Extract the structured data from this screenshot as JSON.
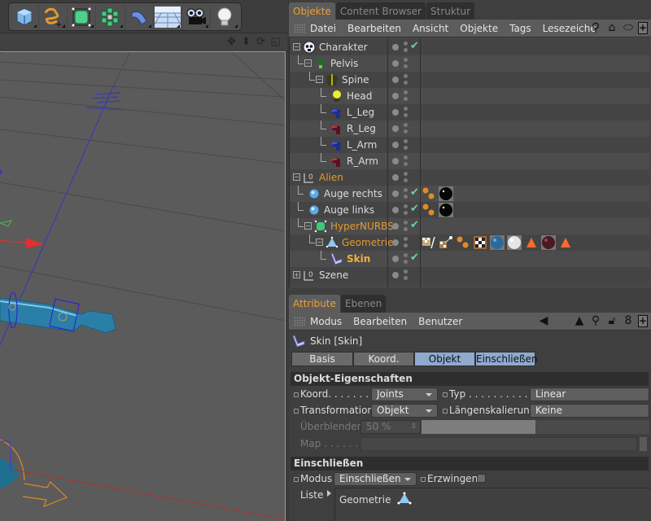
{
  "toolbar": {
    "tools": [
      {
        "name": "cube-tool",
        "icon": "cube-icon"
      },
      {
        "name": "spline-tool",
        "icon": "spline-pen-icon"
      },
      {
        "name": "nurbs-tool",
        "icon": "subdivision-cube-icon"
      },
      {
        "name": "array-tool",
        "icon": "cloner-icon"
      },
      {
        "name": "deformer-tool",
        "icon": "bend-deformer-icon"
      },
      {
        "name": "floor-tool",
        "icon": "floor-grid-icon"
      },
      {
        "name": "camera-tool",
        "icon": "camera-icon"
      },
      {
        "name": "light-tool",
        "icon": "light-bulb-icon"
      }
    ]
  },
  "viewport": {
    "nav_icons": [
      "move-icon",
      "zoom-icon",
      "rotate-icon",
      "maximize-icon"
    ]
  },
  "object_manager": {
    "tabs": [
      {
        "label": "Objekte",
        "active": true
      },
      {
        "label": "Content Browser",
        "active": false
      },
      {
        "label": "Struktur",
        "active": false
      }
    ],
    "menu": [
      "Datei",
      "Bearbeiten",
      "Ansicht",
      "Objekte",
      "Tags",
      "Lesezeiche"
    ],
    "menu_icons": [
      "search-icon",
      "home-icon",
      "eye-icon",
      "new-window-icon"
    ],
    "objects": [
      {
        "name": "Charakter",
        "level": 0,
        "expander": "minus",
        "icon": "character-icon",
        "color": "normal",
        "check": true,
        "tags": []
      },
      {
        "name": "Pelvis",
        "level": 1,
        "expander": "minus",
        "icon": "joint-pelvis-icon",
        "color": "normal",
        "check": false,
        "tags": []
      },
      {
        "name": "Spine",
        "level": 2,
        "expander": "minus",
        "icon": "joint-spine-icon",
        "color": "normal",
        "check": false,
        "tags": []
      },
      {
        "name": "Head",
        "level": 3,
        "expander": "none",
        "icon": "joint-head-icon",
        "color": "normal",
        "check": false,
        "tags": []
      },
      {
        "name": "L_Leg",
        "level": 3,
        "expander": "none",
        "icon": "joint-left-icon",
        "color": "normal",
        "check": false,
        "tags": []
      },
      {
        "name": "R_Leg",
        "level": 3,
        "expander": "none",
        "icon": "joint-right-icon",
        "color": "normal",
        "check": false,
        "tags": []
      },
      {
        "name": "L_Arm",
        "level": 3,
        "expander": "none",
        "icon": "joint-left-icon",
        "color": "normal",
        "check": false,
        "tags": []
      },
      {
        "name": "R_Arm",
        "level": 3,
        "expander": "none",
        "icon": "joint-right-icon",
        "color": "normal",
        "check": false,
        "tags": []
      },
      {
        "name": "Alien",
        "level": 0,
        "expander": "minus",
        "icon": "null-object-icon",
        "color": "orange",
        "check": false,
        "tags": []
      },
      {
        "name": "Auge rechts",
        "level": 1,
        "expander": "none",
        "icon": "sphere-icon",
        "color": "normal",
        "check": true,
        "tags": [
          "phong-tag-icon",
          "material-black-icon"
        ]
      },
      {
        "name": "Auge links",
        "level": 1,
        "expander": "none",
        "icon": "sphere-icon",
        "color": "normal",
        "check": true,
        "tags": [
          "phong-tag-icon",
          "material-black-icon"
        ]
      },
      {
        "name": "HyperNURBS",
        "level": 1,
        "expander": "minus",
        "icon": "hypernurbs-icon",
        "color": "orange",
        "check": true,
        "tags": []
      },
      {
        "name": "Geometrie",
        "level": 2,
        "expander": "minus",
        "icon": "polygon-object-icon",
        "color": "orange",
        "check": false,
        "tags": [
          "weight-tag-icon",
          "vertex-map-tag-icon",
          "phong-tag-icon",
          "uvw-tag-icon",
          "material-blue-icon",
          "material-white-icon",
          "selection-tag-icon",
          "material-darkred-icon",
          "selection-tag-icon"
        ]
      },
      {
        "name": "Skin",
        "level": 3,
        "expander": "none",
        "icon": "skin-deformer-icon",
        "color": "highlight",
        "check": true,
        "tags": []
      },
      {
        "name": "Szene",
        "level": 0,
        "expander": "plus",
        "icon": "null-object-icon",
        "color": "normal",
        "check": false,
        "tags": []
      }
    ]
  },
  "attribute_manager": {
    "tabs": [
      {
        "label": "Attribute",
        "active": true
      },
      {
        "label": "Ebenen",
        "active": false
      }
    ],
    "menu": [
      "Modus",
      "Bearbeiten",
      "Benutzer"
    ],
    "menu_icons": [
      "back-arrow-icon",
      "up-arrow-icon",
      "search-icon",
      "lock-icon",
      "link-icon",
      "new-window-icon"
    ],
    "title": "Skin [Skin]",
    "sub_tabs": [
      {
        "label": "Basis",
        "active": false
      },
      {
        "label": "Koord.",
        "active": false
      },
      {
        "label": "Objekt",
        "active": true
      },
      {
        "label": "Einschließen",
        "active": true
      }
    ],
    "sections": {
      "object_props": {
        "header": "Objekt-Eigenschaften",
        "koord_label": "Koord. . . . . . . . .",
        "koord_value": "Joints",
        "typ_label": "Typ . . . . . . . . . .",
        "typ_value": "Linear",
        "transformation_label": "Transformation",
        "transformation_value": "Objekt",
        "laengen_label": "Längenskalierung",
        "laengen_value": "Keine",
        "blend_label": "Überblenden",
        "blend_value": "50 %",
        "blend_fraction": 0.5,
        "map_label": "Map . . . . . . . ."
      },
      "include": {
        "header": "Einschließen",
        "modus_label": "Modus",
        "modus_value": "Einschließen",
        "force_label": "Erzwingen",
        "list_label": "Liste",
        "list_items": [
          "Geometrie"
        ]
      }
    }
  }
}
